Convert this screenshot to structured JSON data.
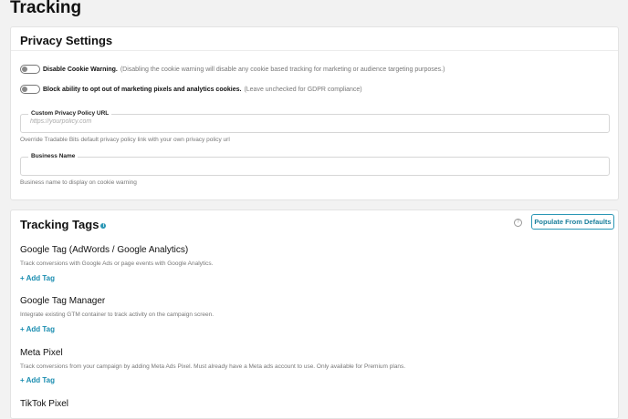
{
  "page": {
    "title": "Tracking"
  },
  "privacy": {
    "title": "Privacy Settings",
    "toggles": [
      {
        "label": "Disable Cookie Warning.",
        "hint": "(Disabling the cookie warning will disable any cookie based tracking for marketing or audience targeting purposes.)",
        "enabled": false
      },
      {
        "label": "Block ability to opt out of marketing pixels and analytics cookies.",
        "hint": "(Leave unchecked for GDPR compliance)",
        "enabled": false
      }
    ],
    "fields": [
      {
        "label": "Custom Privacy Policy URL",
        "value": "",
        "placeholder": "https://yourpolicy.com",
        "helper": "Override Tradable Bits default privacy policy link with your own privacy policy url"
      },
      {
        "label": "Business Name",
        "value": "",
        "placeholder": "",
        "helper": "Business name to display on cookie warning"
      }
    ]
  },
  "tracking": {
    "title": "Tracking Tags",
    "info_icon": "i",
    "help_icon": "?",
    "populate_label": "Populate From Defaults",
    "accent": "#2b97b5",
    "tags": [
      {
        "name": "Google Tag (AdWords / Google Analytics)",
        "desc": "Track conversions with Google Ads or page events with Google Analytics.",
        "add_label": "+ Add Tag"
      },
      {
        "name": "Google Tag Manager",
        "desc": "Integrate existing GTM container to track activity on the campaign screen.",
        "add_label": "+ Add Tag"
      },
      {
        "name": "Meta Pixel",
        "desc": "Track conversions from your campaign by adding Meta Ads Pixel. Must already have a Meta ads account to use. Only available for Premium plans.",
        "add_label": "+ Add Tag"
      },
      {
        "name": "TikTok Pixel"
      }
    ]
  }
}
